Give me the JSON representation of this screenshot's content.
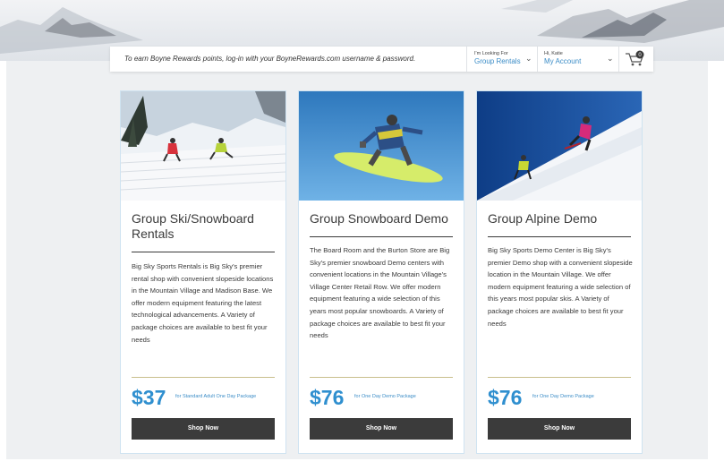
{
  "topbar": {
    "message": "To earn Boyne Rewards points, log-in with your BoyneRewards.com username & password.",
    "looking_for_label": "I'm Looking For",
    "looking_for_value": "Group Rentals",
    "greeting": "Hi, Katie",
    "account_label": "My Account",
    "cart_count": "0"
  },
  "cards": [
    {
      "title": "Group Ski/Snowboard Rentals",
      "description": "Big Sky Sports Rentals is Big Sky's premier rental shop with convenient slopeside locations in the Mountain Village and Madison Base. We offer modern equipment featuring the latest technological advancements. A Variety of package choices are available to best fit your needs",
      "price": "$37",
      "price_note": "for Standard Adult One Day Package",
      "button": "Shop Now"
    },
    {
      "title": "Group Snowboard Demo",
      "description": "The Board Room and the Burton Store are Big Sky's premier snowboard Demo centers with convenient locations in the Mountain Village's Village Center Retail Row. We offer modern equipment featuring a wide selection of this years most popular snowboards. A Variety of package choices are available to best fit your needs",
      "price": "$76",
      "price_note": "for One Day Demo Package",
      "button": "Shop Now"
    },
    {
      "title": "Group Alpine Demo",
      "description": "Big Sky Sports Demo Center is Big Sky's premier Demo shop with a convenient slopeside location in the Mountain Village. We offer modern equipment featuring a wide selection of this years most popular skis. A Variety of package choices are available to best fit your needs",
      "price": "$76",
      "price_note": "for One Day Demo Package",
      "button": "Shop Now"
    }
  ],
  "colors": {
    "accent": "#2f8fcf",
    "button": "#3b3b3b",
    "background": "#eef0f2"
  }
}
